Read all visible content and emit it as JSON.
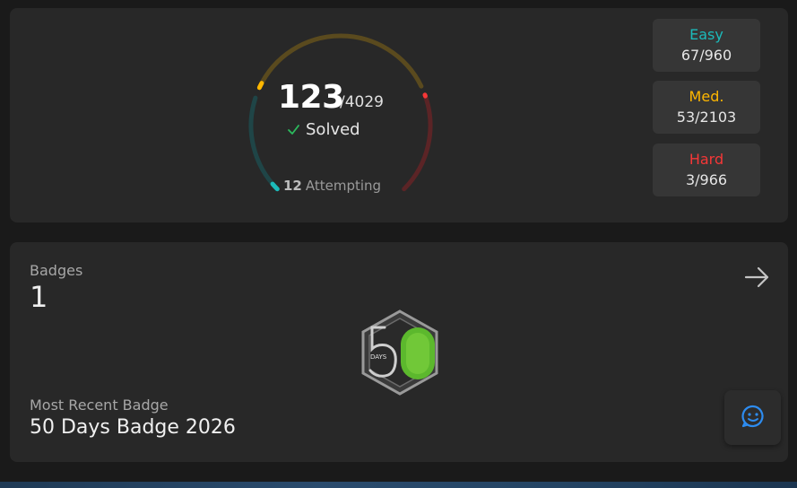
{
  "progress": {
    "solved": "123",
    "total": "/4029",
    "solved_label": "Solved",
    "attempting_count": "12",
    "attempting_label": "Attempting",
    "difficulties": [
      {
        "name": "Easy",
        "value": "67/960",
        "color": "#1cbaba"
      },
      {
        "name": "Med.",
        "value": "53/2103",
        "color": "#ffb700"
      },
      {
        "name": "Hard",
        "value": "3/966",
        "color": "#f63737"
      }
    ]
  },
  "badges": {
    "title": "Badges",
    "count": "1",
    "recent_label": "Most Recent Badge",
    "recent_name": "50 Days Badge 2026",
    "badge_icon": "50-days-badge-icon",
    "badge_text": "DAYS"
  },
  "icons": {
    "arrow": "arrow-right-icon",
    "check": "check-icon",
    "chat": "chat-smile-icon"
  }
}
